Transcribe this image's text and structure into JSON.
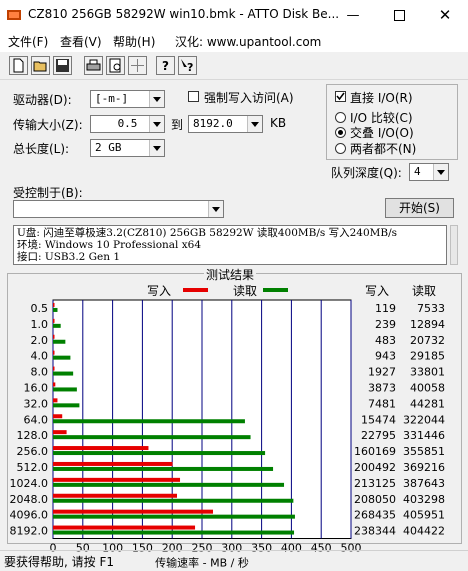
{
  "window": {
    "title": "CZ810 256GB 58292W win10.bmk - ATTO Disk Be...",
    "minimize_icon": "minimize-icon",
    "maximize_icon": "maximize-icon",
    "close_icon": "close-icon"
  },
  "menu": {
    "file": "文件(F)",
    "view": "查看(V)",
    "help": "帮助(H)",
    "sinicize": "汉化: www.upantool.com"
  },
  "toolbar": {
    "icons": [
      "new-file-icon",
      "open-folder-icon",
      "save-icon",
      "print-icon",
      "print-preview-icon",
      "move-icon",
      "help-icon",
      "context-help-icon"
    ]
  },
  "settings": {
    "drive_label": "驱动器(D):",
    "drive_value": "[-m-]",
    "force_write_label": "强制写入访问(A)",
    "direct_io_label": "直接 I/O(R)",
    "direct_io_checked": true,
    "transfer_size_label": "传输大小(Z):",
    "transfer_from": "0.5",
    "to_label": "到",
    "transfer_to": "8192.0",
    "kb_label": "KB",
    "io_compare_label": "I/O 比较(C)",
    "overlapped_io_label": "交叠 I/O(O)",
    "neither_label": "两者都不(N)",
    "total_length_label": "总长度(L):",
    "total_length_value": "2 GB",
    "queue_depth_label": "队列深度(Q):",
    "queue_depth_value": "4",
    "controlled_by_label": "受控制于(B):",
    "controlled_by_value": "",
    "start_button": "开始(S)"
  },
  "info": {
    "line1": "U盘: 闪迪至尊极速3.2(CZ810) 256GB 58292W 读取400MB/s 写入240MB/s",
    "line2": "环境: Windows 10 Professional x64",
    "line3": "接口: USB3.2 Gen 1"
  },
  "results": {
    "group_title": "测试结果",
    "write_col": "写入",
    "read_col": "读取"
  },
  "colors": {
    "write": "#e60000",
    "read": "#008000",
    "grid": "#000080"
  },
  "chart_data": {
    "type": "bar",
    "orientation": "horizontal",
    "title": "测试结果",
    "xlabel": "传输速率 - MB / 秒",
    "xlim": [
      0,
      500
    ],
    "xticks": [
      0,
      50,
      100,
      150,
      200,
      250,
      300,
      350,
      400,
      450,
      500
    ],
    "categories": [
      "0.5",
      "1.0",
      "2.0",
      "4.0",
      "8.0",
      "16.0",
      "32.0",
      "64.0",
      "128.0",
      "256.0",
      "512.0",
      "1024.0",
      "2048.0",
      "4096.0",
      "8192.0"
    ],
    "series": [
      {
        "name": "写入",
        "values": [
          0.12,
          0.24,
          0.48,
          0.94,
          1.93,
          3.87,
          7.48,
          15.47,
          22.8,
          160.17,
          200.49,
          213.13,
          208.05,
          268.44,
          238.34
        ]
      },
      {
        "name": "读取",
        "values": [
          7.53,
          12.89,
          20.73,
          29.19,
          33.8,
          40.06,
          44.28,
          322.04,
          331.45,
          355.85,
          369.22,
          387.64,
          403.3,
          405.95,
          404.42
        ]
      }
    ],
    "write_raw": [
      "119",
      "239",
      "483",
      "943",
      "1927",
      "3873",
      "7481",
      "15474",
      "22795",
      "160169",
      "200492",
      "213125",
      "208050",
      "268435",
      "238344"
    ],
    "read_raw": [
      "7533",
      "12894",
      "20732",
      "29185",
      "33801",
      "40058",
      "44281",
      "322044",
      "331446",
      "355851",
      "369216",
      "387643",
      "403298",
      "405951",
      "404422"
    ],
    "legend": "top-center",
    "grid": true
  },
  "status": {
    "text": "要获得帮助, 请按 F1"
  }
}
